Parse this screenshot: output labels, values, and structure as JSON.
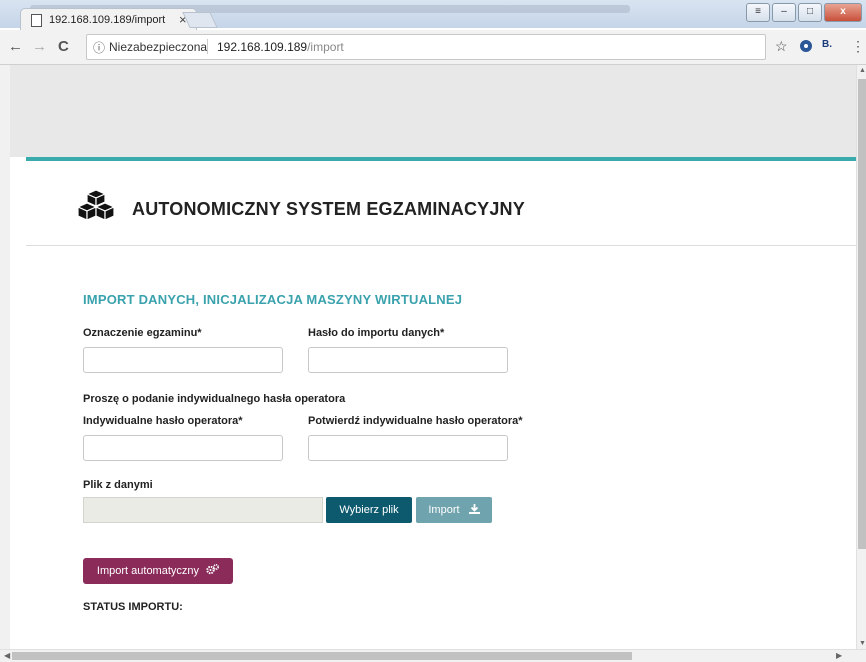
{
  "browser": {
    "tab_title": "192.168.109.189/import",
    "tab_close": "×",
    "security_label": "Niezabezpieczona",
    "url_host": "192.168.109.189",
    "url_path": "/import",
    "back": "←",
    "forward": "→",
    "reload": "C",
    "info": "ⓘ",
    "bookmark": "☆",
    "ext_label": "B.",
    "menu": "⋮",
    "win_min": "–",
    "win_max": "□",
    "win_close": "x",
    "user_icon": "≡"
  },
  "app": {
    "title": "AUTONOMICZNY SYSTEM EGZAMINACYJNY",
    "logo_icon": "cubes-icon"
  },
  "form": {
    "section_title": "IMPORT DANYCH, INICJALIZACJA MASZYNY WIRTUALNEJ",
    "exam_label": "Oznaczenie egzaminu*",
    "exam_value": "",
    "import_password_label": "Hasło do importu danych*",
    "import_password_value": "",
    "operator_note": "Proszę o podanie indywidualnego hasła operatora",
    "operator_password_label": "Indywidualne hasło operatora*",
    "operator_password_confirm_label": "Potwierdź indywidualne hasło operatora*",
    "file_label": "Plik z danymi",
    "choose_file_button": "Wybierz plik",
    "import_button": "Import",
    "import_icon": "download-icon",
    "auto_import_button": "Import automatyczny",
    "auto_import_icon": "gears-icon",
    "status_label": "STATUS IMPORTU:"
  },
  "colors": {
    "accent_teal": "#3aabad",
    "choose_button": "#0d5a6e",
    "import_button": "#6fa3ad",
    "auto_import_button": "#8a2b5a"
  }
}
